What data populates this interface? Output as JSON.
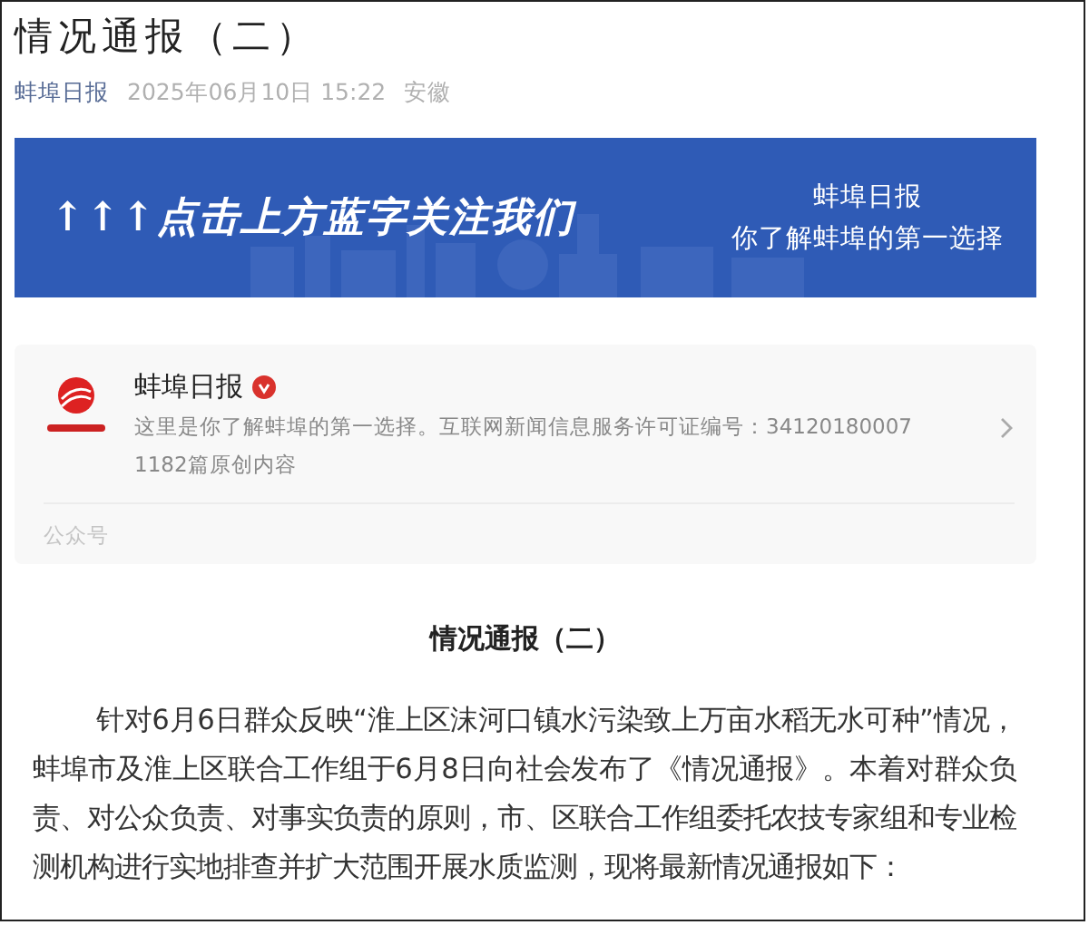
{
  "article": {
    "title": "情况通报（二）",
    "source": "蚌埠日报",
    "date": "2025年06月10日 15:22",
    "location": "安徽"
  },
  "banner": {
    "slogan": "↑↑↑点击上方蓝字关注我们",
    "name": "蚌埠日报",
    "tagline": "你了解蚌埠的第一选择"
  },
  "account_card": {
    "name": "蚌埠日报",
    "verified": true,
    "description": "这里是你了解蚌埠的第一选择。互联网新闻信息服务许可证编号：34120180007",
    "original_count": "1182篇原创内容",
    "footer": "公众号"
  },
  "body": {
    "heading": "情况通报（二）",
    "paragraphs": [
      "针对6月6日群众反映“淮上区沫河口镇水污染致上万亩水稻无水可种”情况，蚌埠市及淮上区联合工作组于6月8日向社会发布了《情况通报》。本着对群众负责、对公众负责、对事实负责的原则，市、区联合工作组委托农技专家组和专业检测机构进行实地排查并扩大范围开展水质监测，现将最新情况通报如下："
    ]
  }
}
